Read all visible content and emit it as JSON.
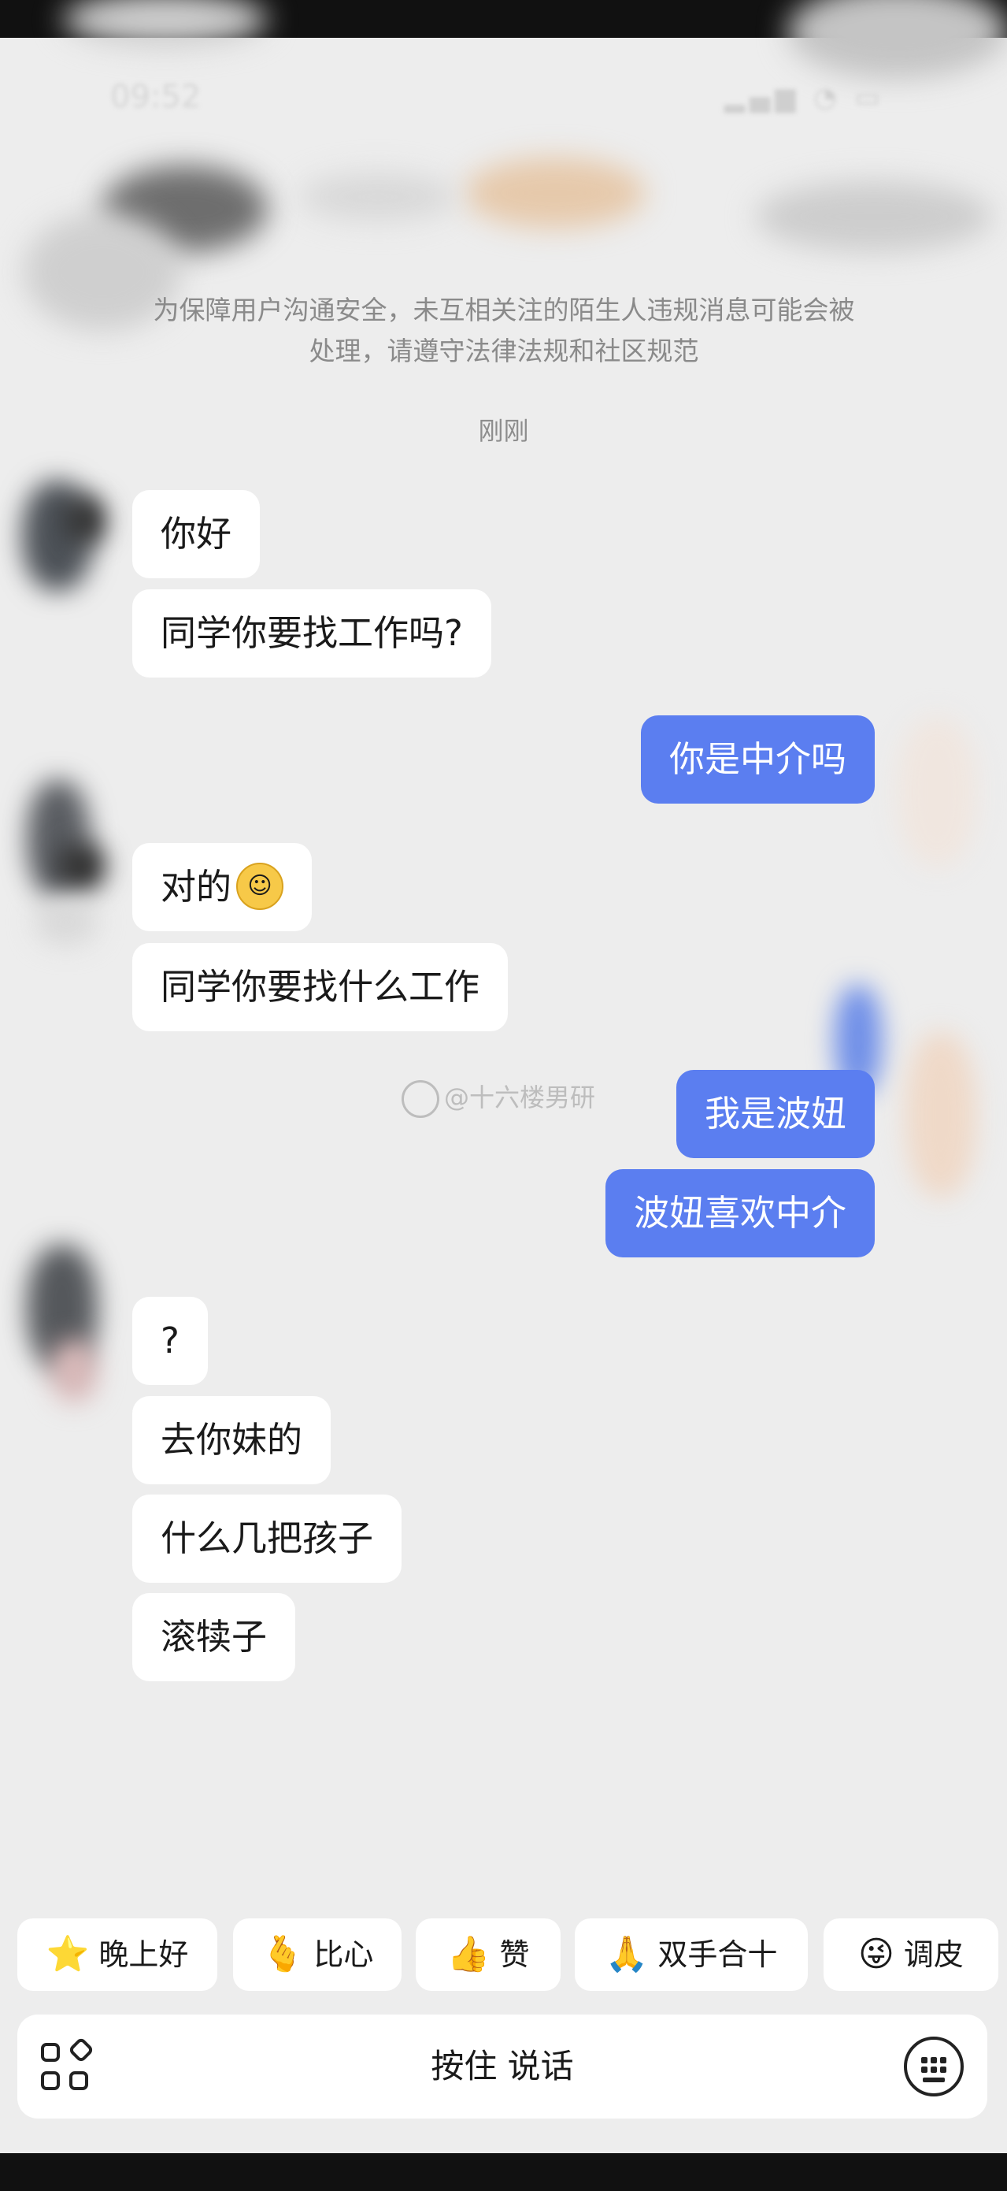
{
  "notice": {
    "line1": "为保障用户沟通安全，未互相关注的陌生人违规消息可能会被",
    "line2": "处理，请遵守法律法规和社区规范"
  },
  "timestamp": "刚刚",
  "messages": [
    {
      "side": "left",
      "text": "你好"
    },
    {
      "side": "left",
      "text": "同学你要找工作吗?"
    },
    {
      "side": "right",
      "text": "你是中介吗"
    },
    {
      "side": "left",
      "text": "对的",
      "emoji": "smile-emoji"
    },
    {
      "side": "left",
      "text": "同学你要找什么工作"
    },
    {
      "side": "right",
      "text": "我是波妞"
    },
    {
      "side": "right",
      "text": "波妞喜欢中介"
    },
    {
      "side": "left",
      "text": "?"
    },
    {
      "side": "left",
      "text": "去你妹的"
    },
    {
      "side": "left",
      "text": "什么几把孩子"
    },
    {
      "side": "left",
      "text": "滚犊子"
    }
  ],
  "watermark": "@十六楼男研",
  "quick_replies": [
    {
      "icon": "star-emoji",
      "glyph": "⭐",
      "label": "晚上好"
    },
    {
      "icon": "heart-hands-emoji",
      "glyph": "🫰",
      "label": "比心"
    },
    {
      "icon": "thumbs-up-emoji",
      "glyph": "👍",
      "label": "赞"
    },
    {
      "icon": "pray-emoji",
      "glyph": "🙏",
      "label": "双手合十"
    },
    {
      "icon": "wink-tongue-emoji",
      "glyph": "😜",
      "label": "调皮"
    }
  ],
  "input_bar": {
    "hold_to_talk": "按住 说话",
    "left_icon": "apps-grid-icon",
    "right_icon": "keyboard-icon"
  },
  "colors": {
    "background": "#ededed",
    "sent_bubble": "#5b7ef0",
    "received_bubble": "#ffffff"
  }
}
